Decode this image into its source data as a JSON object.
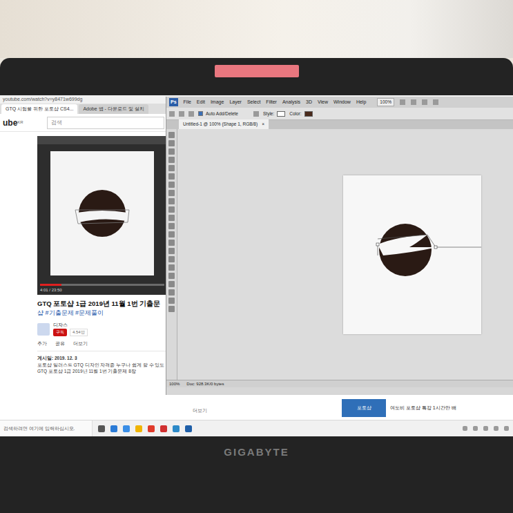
{
  "browser": {
    "url": "youtube.com/watch?v=y8471w699dg",
    "tabs": [
      {
        "label": "GTQ 시험을 위한 포토샵 CS4...",
        "selected": true
      },
      {
        "label": "Adobe 앱 - 다운로드 및 설치",
        "selected": false
      }
    ],
    "logo": "ube",
    "logo_region": "KR",
    "search": {
      "placeholder": "검색"
    },
    "video": {
      "time": "4:01 / 23:50",
      "level": 0.17
    },
    "title": "GTQ 포토샵 1급 2019년 11월 1번 기출문",
    "tags": "샵 #기출문제 #문제풀이",
    "channel": "디자스",
    "subscribe": "구독",
    "subscribers": "4.54만",
    "actions": [
      "추가",
      "공유",
      "더보기"
    ],
    "date": "게시일: 2019. 12. 3",
    "description": [
      "포토샵 일러스트 GTQ 디자인 자격증 누구나 쉽게 할 수 있도",
      "GTQ 포토샵 1급 2019년 11월 1번 기출문제 8장"
    ],
    "more": "더보기",
    "related": {
      "thumb_label": "포토샵",
      "title": "여도비 포토샵 특강 1시간만 배"
    }
  },
  "photoshop": {
    "logo": "Ps",
    "menu": [
      "File",
      "Edit",
      "Image",
      "Layer",
      "Select",
      "Filter",
      "Analysis",
      "3D",
      "View",
      "Window",
      "Help"
    ],
    "zoom": "100%",
    "options": {
      "auto": "Auto Add/Delete",
      "auto_checked": true,
      "style": "Style:",
      "color": "Color:"
    },
    "document_tab": "Untitled-1 @ 100% (Shape 1, RGB/8)",
    "close": "×",
    "status_zoom": "100%",
    "doc_info": "Doc: 928.3K/0 bytes"
  },
  "taskbar": {
    "search": {
      "placeholder": "검색하려면 여기에 입력하십시오."
    }
  },
  "laptop": {
    "brand": "GIGABYTE"
  }
}
